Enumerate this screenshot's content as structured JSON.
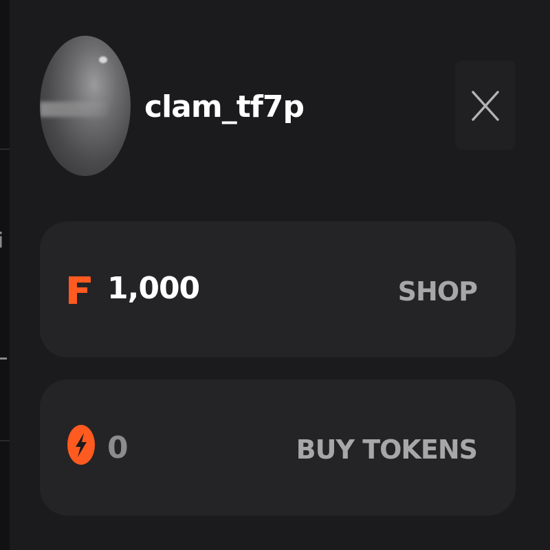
{
  "profile": {
    "username": "clam_tf7p"
  },
  "wallet": {
    "coins": {
      "amount": "1,000",
      "action_label": "SHOP",
      "icon": "f-coin-icon"
    },
    "tokens": {
      "amount": "0",
      "action_label": "BUY TOKENS",
      "icon": "lightning-token-icon"
    }
  },
  "colors": {
    "accent": "#ff5a1f",
    "panel_bg": "#1b1b1d",
    "card_bg": "#242426"
  },
  "icons": {
    "close": "close-icon"
  }
}
